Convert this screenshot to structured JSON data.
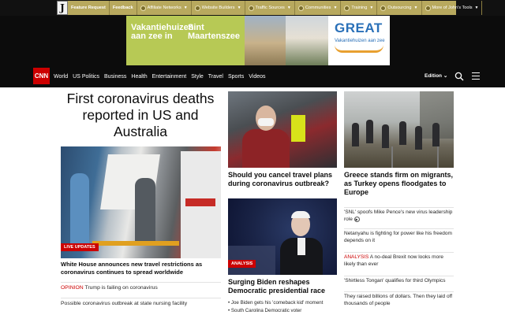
{
  "toolbar": {
    "logo_letter": "J",
    "feature_request": "Feature Request",
    "feedback": "Feedback",
    "dropdowns": [
      "Affiliate Networks",
      "Website Builders",
      "Traffic Sources",
      "Communities",
      "Training",
      "Outsourcing",
      "More of John's Tools"
    ]
  },
  "ad": {
    "line1a": "Vakantiehuizen",
    "line1b": "aan zee in",
    "line2a": "Sint",
    "line2b": "Maartenszee",
    "brand": "GREAT",
    "brand_sub": "Vakantiehuizen aan zee"
  },
  "nav": {
    "logo": "CNN",
    "links": [
      "World",
      "US Politics",
      "Business",
      "Health",
      "Entertainment",
      "Style",
      "Travel",
      "Sports",
      "Videos"
    ],
    "edition": "Edition"
  },
  "lead": {
    "headline": "First coronavirus deaths reported in US and Australia",
    "badge": "LIVE UPDATES",
    "caption": "White House announces new travel restrictions as coronavirus continues to spread worldwide",
    "related": [
      {
        "tag": "OPINION",
        "text": "Trump is failing on coronavirus"
      },
      {
        "tag": "",
        "text": "Possible coronavirus outbreak at state nursing facility"
      }
    ]
  },
  "middle": {
    "story1": "Should you cancel travel plans during coronavirus outbreak?",
    "badge": "ANALYSIS",
    "story2": "Surging Biden reshapes Democratic presidential race",
    "bullets": [
      "Joe Biden gets his 'comeback kid' moment",
      "South Carolina Democratic voter"
    ]
  },
  "right": {
    "story": "Greece stands firm on migrants, as Turkey opens floodgates to Europe",
    "items": [
      {
        "tag": "",
        "text": "'SNL' spoofs Mike Pence's new virus leadership role"
      },
      {
        "tag": "",
        "text": "Netanyahu is fighting for power like his freedom depends on it"
      },
      {
        "tag": "ANALYSIS",
        "text": "A no-deal Brexit now looks more likely than ever"
      },
      {
        "tag": "",
        "text": "'Shirtless Tongan' qualifies for third Olympics"
      },
      {
        "tag": "",
        "text": "They raised billions of dollars. Then they laid off thousands of people"
      }
    ]
  }
}
